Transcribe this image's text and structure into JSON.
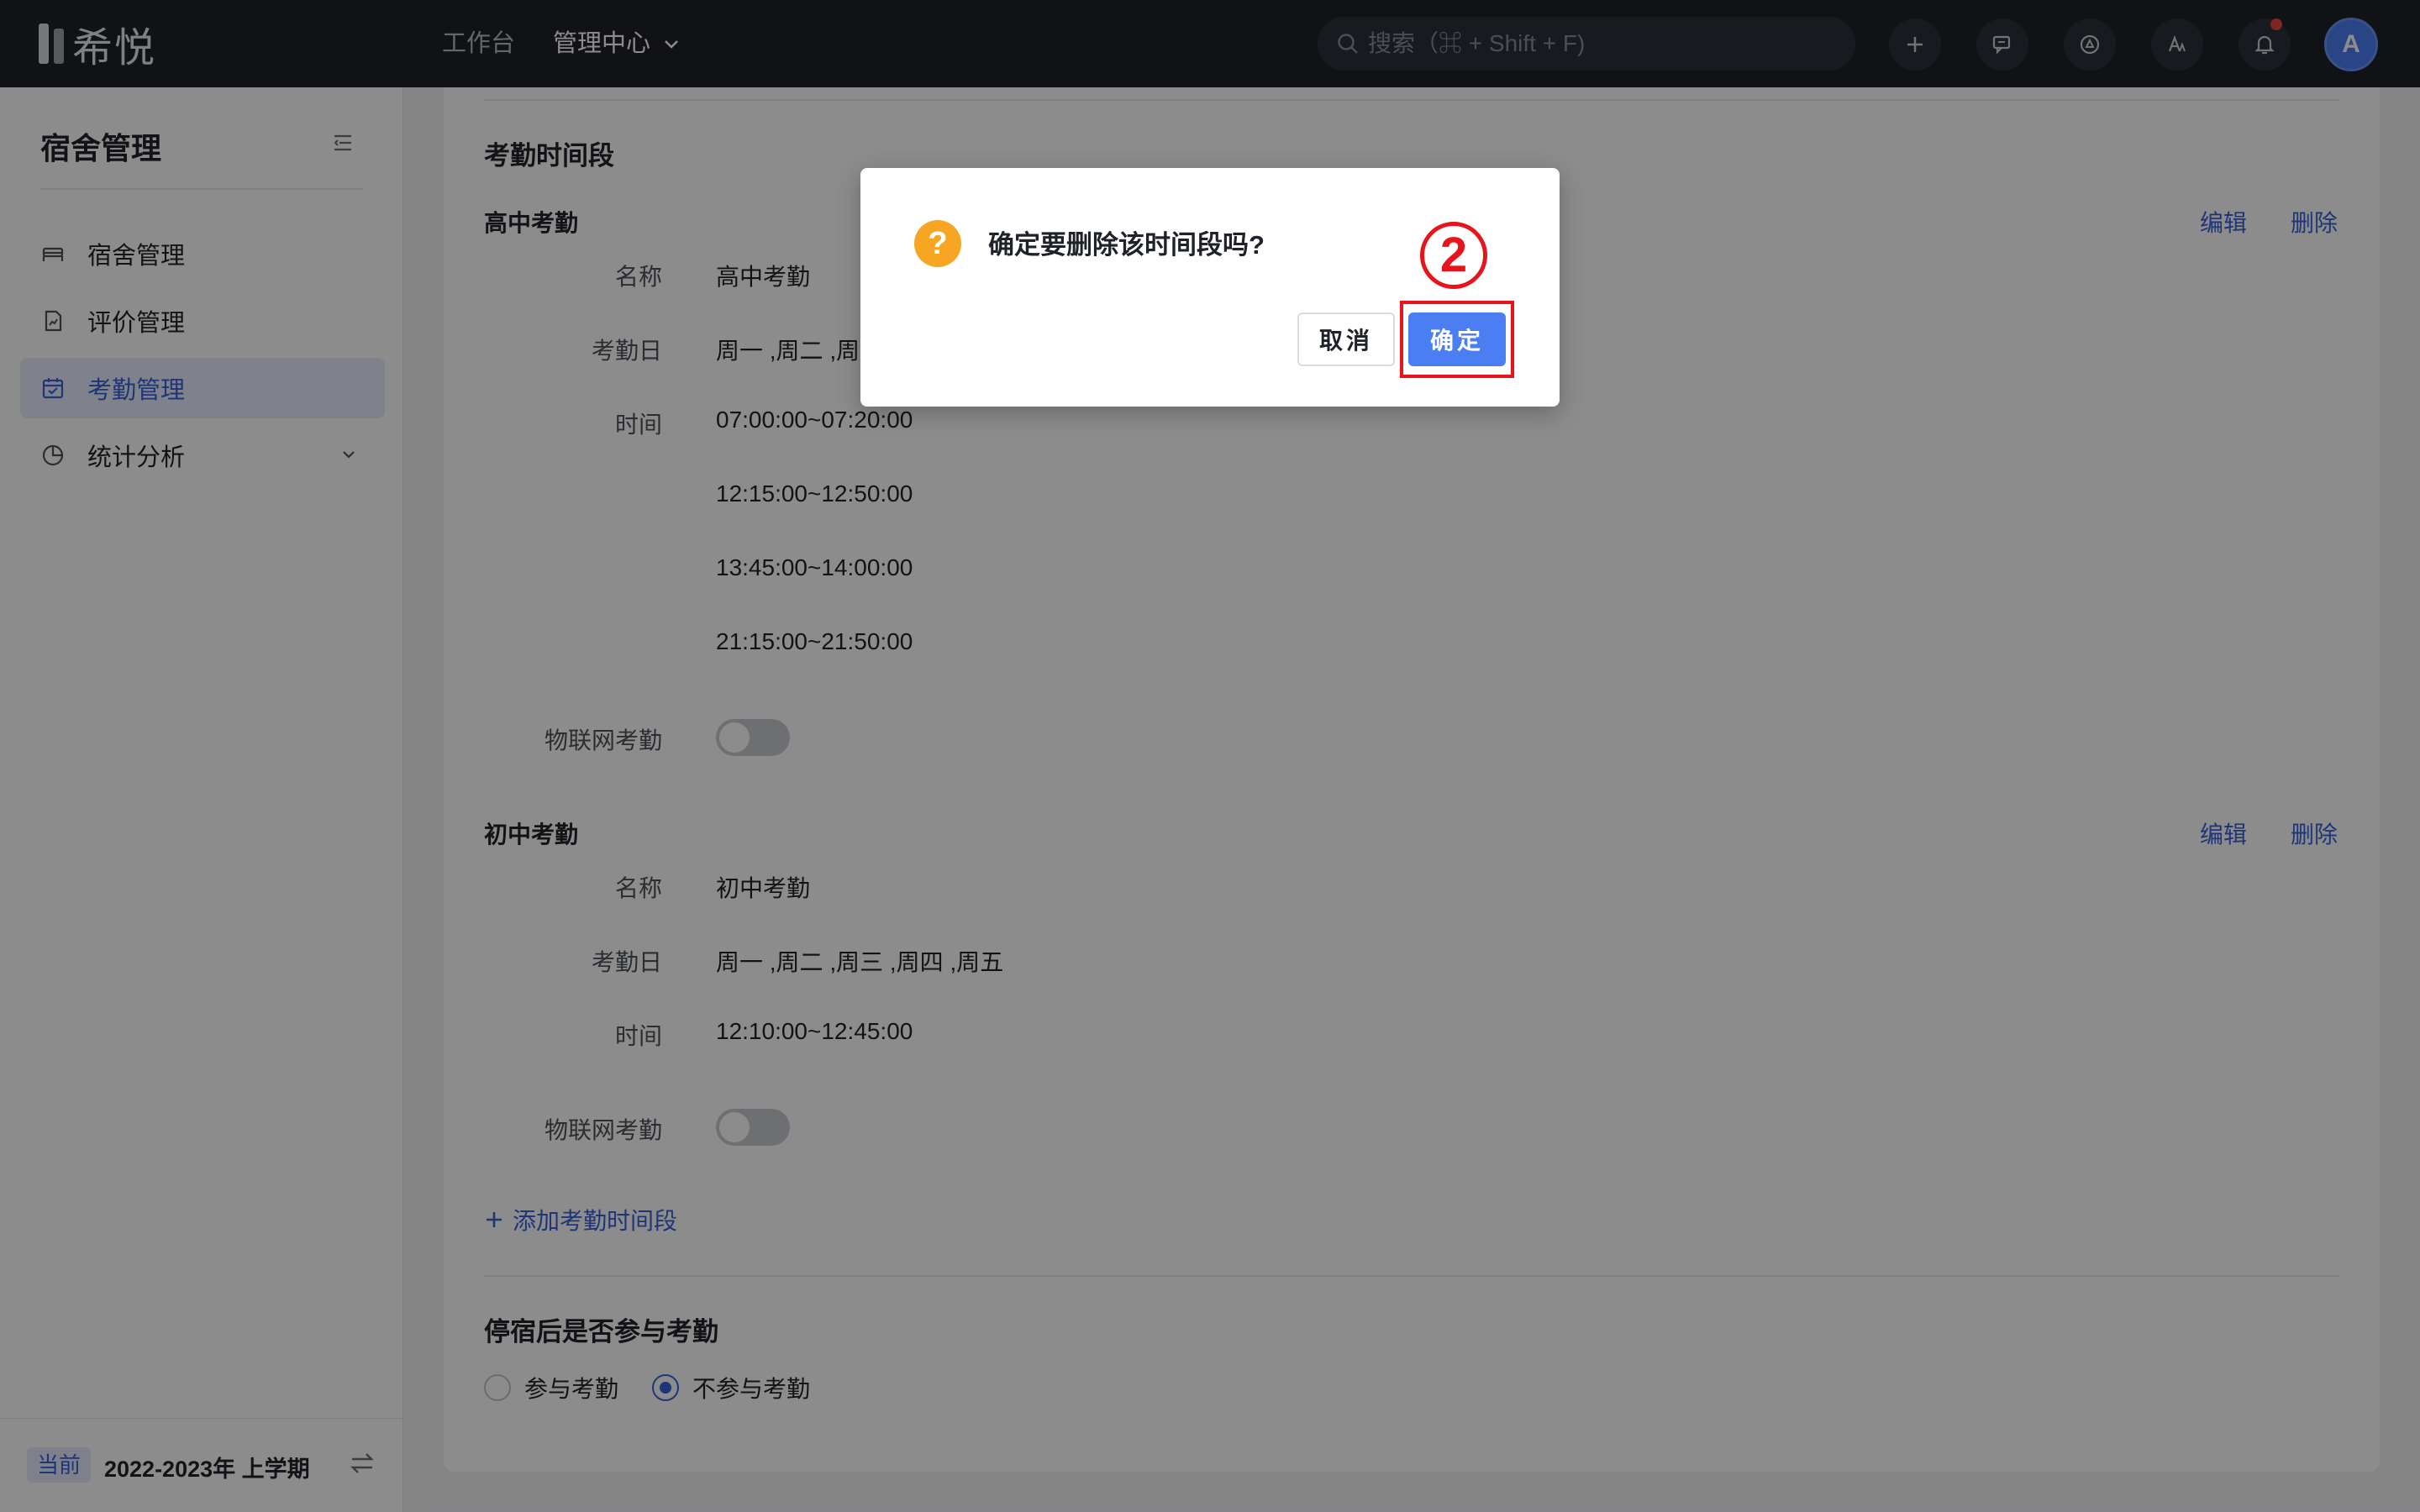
{
  "topbar": {
    "logo_text": "希悦",
    "nav": [
      "工作台",
      "管理中心"
    ],
    "search_placeholder": "搜索（⌘ + Shift + F)",
    "avatar_letter": "A",
    "notification_dot_color": "#e5453d"
  },
  "sidebar": {
    "title": "宿舍管理",
    "items": [
      {
        "label": "宿舍管理",
        "icon": "bed-icon"
      },
      {
        "label": "评价管理",
        "icon": "report-icon"
      },
      {
        "label": "考勤管理",
        "icon": "calendar-check-icon",
        "active": true
      },
      {
        "label": "统计分析",
        "icon": "pie-chart-icon",
        "expandable": true
      }
    ],
    "footer": {
      "tag": "当前",
      "term": "2022-2023年 上学期"
    }
  },
  "main": {
    "section_title": "考勤时间段",
    "groups": [
      {
        "title": "高中考勤",
        "edit": "编辑",
        "delete": "删除",
        "name_label": "名称",
        "name_value": "高中考勤",
        "days_label": "考勤日",
        "days_value": "周一 ,周二 ,周",
        "time_label": "时间",
        "times": [
          "07:00:00~07:20:00",
          "12:15:00~12:50:00",
          "13:45:00~14:00:00",
          "21:15:00~21:50:00"
        ],
        "iot_label": "物联网考勤",
        "iot_on": false
      },
      {
        "title": "初中考勤",
        "edit": "编辑",
        "delete": "删除",
        "name_label": "名称",
        "name_value": "初中考勤",
        "days_label": "考勤日",
        "days_value": "周一 ,周二 ,周三 ,周四 ,周五",
        "time_label": "时间",
        "times": [
          "12:10:00~12:45:00"
        ],
        "iot_label": "物联网考勤",
        "iot_on": false
      }
    ],
    "add_link": "添加考勤时间段",
    "after_stop_title": "停宿后是否参与考勤",
    "options": [
      {
        "label": "参与考勤",
        "selected": false
      },
      {
        "label": "不参与考勤",
        "selected": true
      }
    ]
  },
  "modal": {
    "title": "确定要删除该时间段吗?",
    "cancel": "取消",
    "ok": "确定",
    "annotation_number": "2",
    "accent_color": "#4c7ef3",
    "highlight_color": "#e8141b"
  }
}
